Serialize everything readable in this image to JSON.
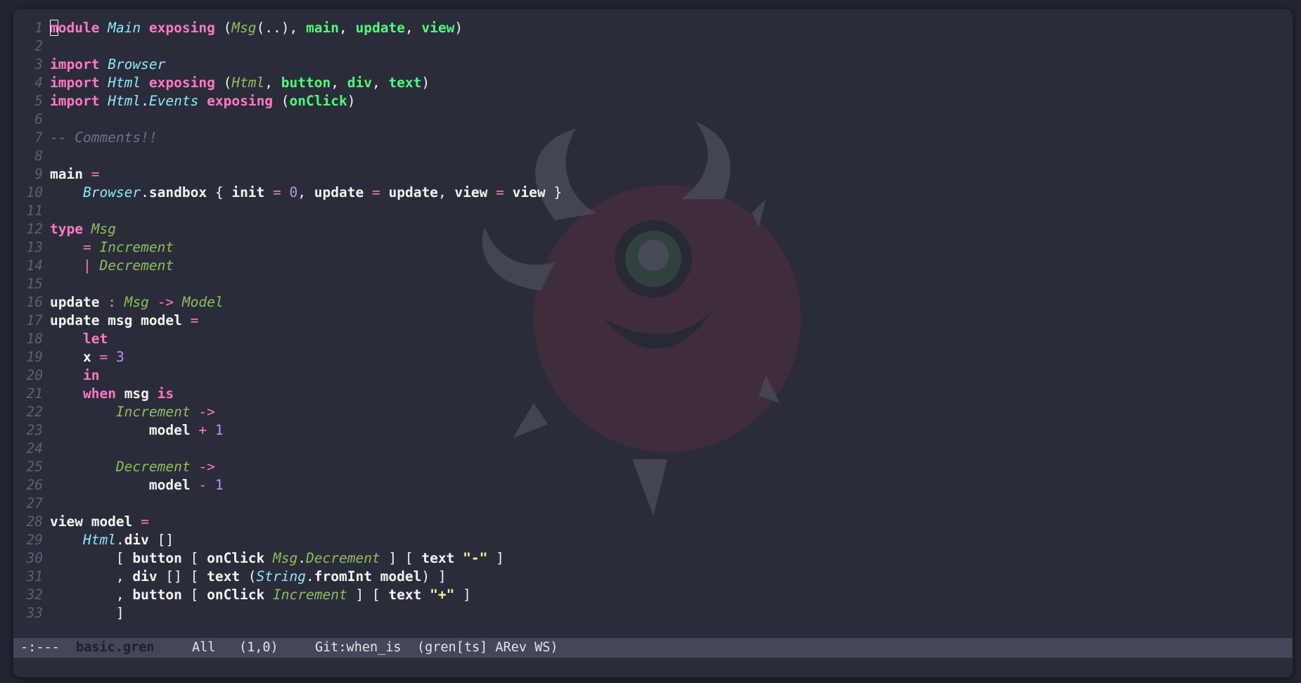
{
  "editor": {
    "lines": [
      {
        "n": "1",
        "tokens": [
          [
            "kw",
            "module"
          ],
          [
            "pn",
            " "
          ],
          [
            "ty",
            "Main"
          ],
          [
            "pn",
            " "
          ],
          [
            "kw",
            "exposing"
          ],
          [
            "pn",
            " ("
          ],
          [
            "ct",
            "Msg"
          ],
          [
            "pn",
            "(..), "
          ],
          [
            "fn",
            "main"
          ],
          [
            "pn",
            ", "
          ],
          [
            "fn",
            "update"
          ],
          [
            "pn",
            ", "
          ],
          [
            "fn",
            "view"
          ],
          [
            "pn",
            ")"
          ]
        ]
      },
      {
        "n": "2",
        "tokens": []
      },
      {
        "n": "3",
        "tokens": [
          [
            "kw",
            "import"
          ],
          [
            "pn",
            " "
          ],
          [
            "ty",
            "Browser"
          ]
        ]
      },
      {
        "n": "4",
        "tokens": [
          [
            "kw",
            "import"
          ],
          [
            "pn",
            " "
          ],
          [
            "ty",
            "Html"
          ],
          [
            "pn",
            " "
          ],
          [
            "kw",
            "exposing"
          ],
          [
            "pn",
            " ("
          ],
          [
            "ct",
            "Html"
          ],
          [
            "pn",
            ", "
          ],
          [
            "fn",
            "button"
          ],
          [
            "pn",
            ", "
          ],
          [
            "fn",
            "div"
          ],
          [
            "pn",
            ", "
          ],
          [
            "fn",
            "text"
          ],
          [
            "pn",
            ")"
          ]
        ]
      },
      {
        "n": "5",
        "tokens": [
          [
            "kw",
            "import"
          ],
          [
            "pn",
            " "
          ],
          [
            "ty",
            "Html"
          ],
          [
            "pn",
            "."
          ],
          [
            "ty",
            "Events"
          ],
          [
            "pn",
            " "
          ],
          [
            "kw",
            "exposing"
          ],
          [
            "pn",
            " ("
          ],
          [
            "fn",
            "onClick"
          ],
          [
            "pn",
            ")"
          ]
        ]
      },
      {
        "n": "6",
        "tokens": []
      },
      {
        "n": "7",
        "tokens": [
          [
            "com",
            "-- Comments!!"
          ]
        ]
      },
      {
        "n": "8",
        "tokens": []
      },
      {
        "n": "9",
        "tokens": [
          [
            "id",
            "main"
          ],
          [
            "pn",
            " "
          ],
          [
            "op",
            "="
          ]
        ]
      },
      {
        "n": "10",
        "tokens": [
          [
            "pn",
            "    "
          ],
          [
            "ty",
            "Browser"
          ],
          [
            "pn",
            "."
          ],
          [
            "id",
            "sandbox"
          ],
          [
            "pn",
            " { "
          ],
          [
            "id",
            "init"
          ],
          [
            "pn",
            " "
          ],
          [
            "op",
            "="
          ],
          [
            "pn",
            " "
          ],
          [
            "num",
            "0"
          ],
          [
            "pn",
            ", "
          ],
          [
            "id",
            "update"
          ],
          [
            "pn",
            " "
          ],
          [
            "op",
            "="
          ],
          [
            "pn",
            " "
          ],
          [
            "id",
            "update"
          ],
          [
            "pn",
            ", "
          ],
          [
            "id",
            "view"
          ],
          [
            "pn",
            " "
          ],
          [
            "op",
            "="
          ],
          [
            "pn",
            " "
          ],
          [
            "id",
            "view"
          ],
          [
            "pn",
            " }"
          ]
        ]
      },
      {
        "n": "11",
        "tokens": []
      },
      {
        "n": "12",
        "tokens": [
          [
            "kw",
            "type"
          ],
          [
            "pn",
            " "
          ],
          [
            "ct",
            "Msg"
          ]
        ]
      },
      {
        "n": "13",
        "tokens": [
          [
            "pn",
            "    "
          ],
          [
            "op",
            "="
          ],
          [
            "pn",
            " "
          ],
          [
            "ct",
            "Increment"
          ]
        ]
      },
      {
        "n": "14",
        "tokens": [
          [
            "pn",
            "    "
          ],
          [
            "op",
            "|"
          ],
          [
            "pn",
            " "
          ],
          [
            "ct",
            "Decrement"
          ]
        ]
      },
      {
        "n": "15",
        "tokens": []
      },
      {
        "n": "16",
        "tokens": [
          [
            "id",
            "update"
          ],
          [
            "pn",
            " "
          ],
          [
            "op",
            ":"
          ],
          [
            "pn",
            " "
          ],
          [
            "ct",
            "Msg"
          ],
          [
            "pn",
            " "
          ],
          [
            "op",
            "->"
          ],
          [
            "pn",
            " "
          ],
          [
            "ct",
            "Model"
          ]
        ]
      },
      {
        "n": "17",
        "tokens": [
          [
            "id",
            "update msg model"
          ],
          [
            "pn",
            " "
          ],
          [
            "op",
            "="
          ]
        ]
      },
      {
        "n": "18",
        "tokens": [
          [
            "pn",
            "    "
          ],
          [
            "kw",
            "let"
          ]
        ]
      },
      {
        "n": "19",
        "tokens": [
          [
            "pn",
            "    "
          ],
          [
            "id",
            "x"
          ],
          [
            "pn",
            " "
          ],
          [
            "op",
            "="
          ],
          [
            "pn",
            " "
          ],
          [
            "num",
            "3"
          ]
        ]
      },
      {
        "n": "20",
        "tokens": [
          [
            "pn",
            "    "
          ],
          [
            "kw",
            "in"
          ]
        ]
      },
      {
        "n": "21",
        "tokens": [
          [
            "pn",
            "    "
          ],
          [
            "kw",
            "when"
          ],
          [
            "pn",
            " "
          ],
          [
            "id",
            "msg"
          ],
          [
            "pn",
            " "
          ],
          [
            "kw",
            "is"
          ]
        ]
      },
      {
        "n": "22",
        "tokens": [
          [
            "pn",
            "        "
          ],
          [
            "ct",
            "Increment"
          ],
          [
            "pn",
            " "
          ],
          [
            "op",
            "->"
          ]
        ]
      },
      {
        "n": "23",
        "tokens": [
          [
            "pn",
            "            "
          ],
          [
            "id",
            "model"
          ],
          [
            "pn",
            " "
          ],
          [
            "op",
            "+"
          ],
          [
            "pn",
            " "
          ],
          [
            "num",
            "1"
          ]
        ]
      },
      {
        "n": "24",
        "tokens": []
      },
      {
        "n": "25",
        "tokens": [
          [
            "pn",
            "        "
          ],
          [
            "ct",
            "Decrement"
          ],
          [
            "pn",
            " "
          ],
          [
            "op",
            "->"
          ]
        ]
      },
      {
        "n": "26",
        "tokens": [
          [
            "pn",
            "            "
          ],
          [
            "id",
            "model"
          ],
          [
            "pn",
            " "
          ],
          [
            "op",
            "-"
          ],
          [
            "pn",
            " "
          ],
          [
            "num",
            "1"
          ]
        ]
      },
      {
        "n": "27",
        "tokens": []
      },
      {
        "n": "28",
        "tokens": [
          [
            "id",
            "view model"
          ],
          [
            "pn",
            " "
          ],
          [
            "op",
            "="
          ]
        ]
      },
      {
        "n": "29",
        "tokens": [
          [
            "pn",
            "    "
          ],
          [
            "ty",
            "Html"
          ],
          [
            "pn",
            "."
          ],
          [
            "id",
            "div"
          ],
          [
            "pn",
            " []"
          ]
        ]
      },
      {
        "n": "30",
        "tokens": [
          [
            "pn",
            "        [ "
          ],
          [
            "id",
            "button"
          ],
          [
            "pn",
            " [ "
          ],
          [
            "id",
            "onClick"
          ],
          [
            "pn",
            " "
          ],
          [
            "ct",
            "Msg"
          ],
          [
            "pn",
            "."
          ],
          [
            "ct",
            "Decrement"
          ],
          [
            "pn",
            " ] [ "
          ],
          [
            "id",
            "text"
          ],
          [
            "pn",
            " "
          ],
          [
            "str",
            "\"-\""
          ],
          [
            "pn",
            " ]"
          ]
        ]
      },
      {
        "n": "31",
        "tokens": [
          [
            "pn",
            "        , "
          ],
          [
            "id",
            "div"
          ],
          [
            "pn",
            " [] [ "
          ],
          [
            "id",
            "text"
          ],
          [
            "pn",
            " ("
          ],
          [
            "ty",
            "String"
          ],
          [
            "pn",
            "."
          ],
          [
            "id",
            "fromInt model"
          ],
          [
            "pn",
            ") ]"
          ]
        ]
      },
      {
        "n": "32",
        "tokens": [
          [
            "pn",
            "        , "
          ],
          [
            "id",
            "button"
          ],
          [
            "pn",
            " [ "
          ],
          [
            "id",
            "onClick"
          ],
          [
            "pn",
            " "
          ],
          [
            "ct",
            "Increment"
          ],
          [
            "pn",
            " ] [ "
          ],
          [
            "id",
            "text"
          ],
          [
            "pn",
            " "
          ],
          [
            "str",
            "\"+\""
          ],
          [
            "pn",
            " ]"
          ]
        ]
      },
      {
        "n": "33",
        "tokens": [
          [
            "pn",
            "        ]"
          ]
        ]
      }
    ]
  },
  "modeline": {
    "state": "-:---",
    "filename": "basic.gren",
    "scroll": "All",
    "position": "(1,0)",
    "vcs": "Git:when_is",
    "modes": "(gren[ts] ARev WS)"
  },
  "watermark": {
    "icon": "one-eyed-horned-monster-icon"
  },
  "colors": {
    "background": "#2a2c3a",
    "keyword": "#ff79c6",
    "module": "#8be9fd",
    "constructor": "#8fbf5a",
    "function": "#50fa7b",
    "number": "#bd93f9",
    "string": "#f1fa8c",
    "comment": "#6d7088",
    "modeline": "#44475a"
  }
}
